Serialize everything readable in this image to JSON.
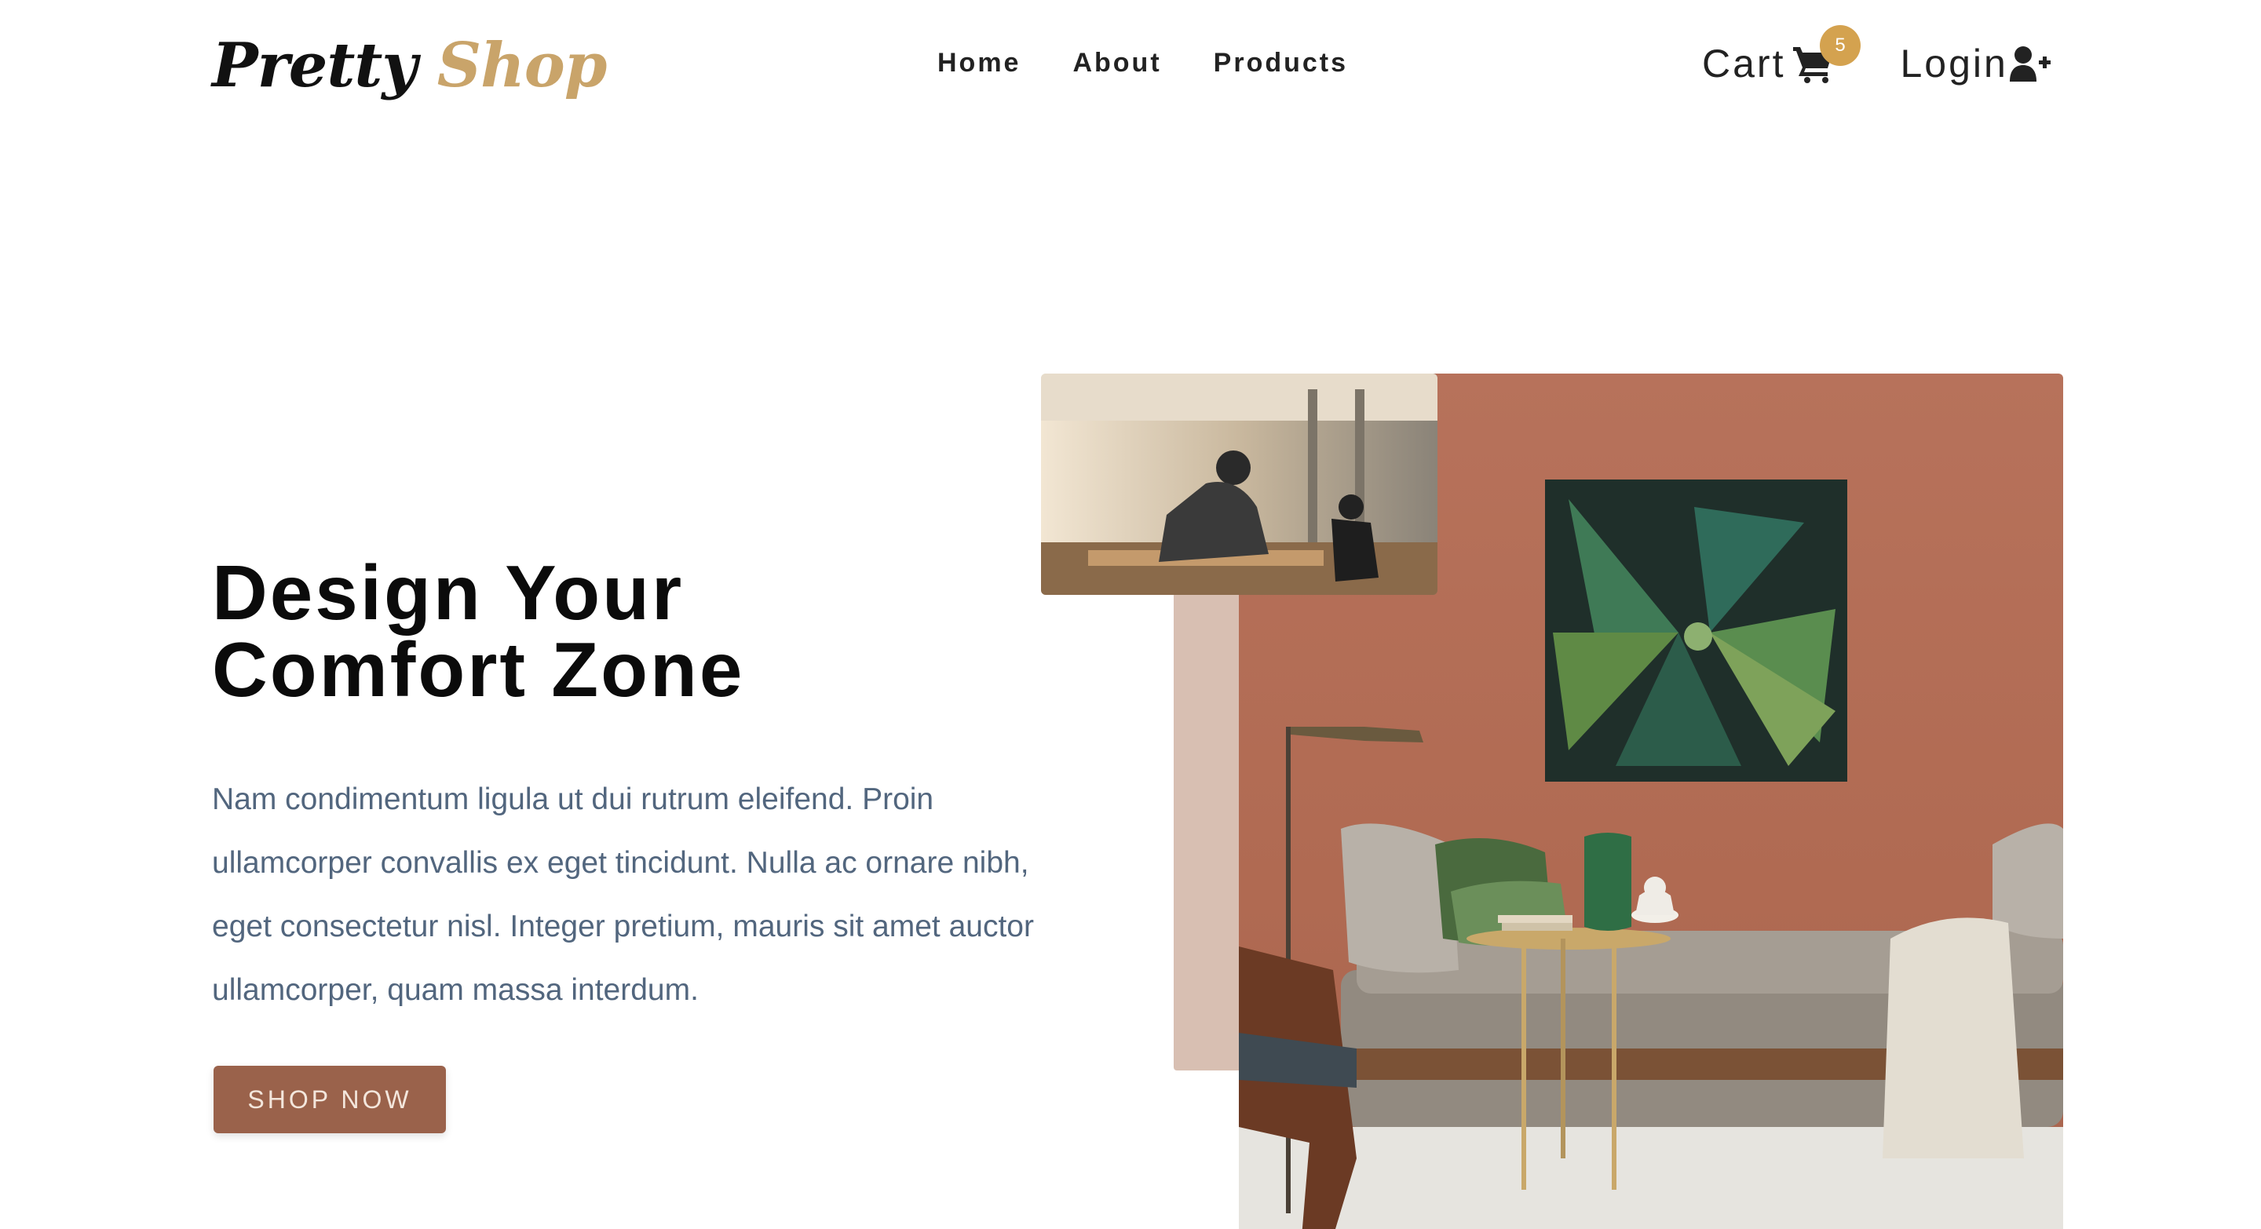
{
  "logo": {
    "part1": "Pretty",
    "part2": "Shop"
  },
  "nav": {
    "links": [
      {
        "label": "Home"
      },
      {
        "label": "About"
      },
      {
        "label": "Products"
      }
    ],
    "cart": {
      "label": "Cart",
      "count": "5",
      "icon": "cart-icon"
    },
    "login": {
      "label": "Login",
      "icon": "user-plus-icon"
    }
  },
  "hero": {
    "title_line1": "Design Your",
    "title_line2": "Comfort Zone",
    "text": "Nam condimentum ligula ut dui rutrum eleifend. Proin ullamcorper convallis ex eget tincidunt. Nulla ac ornare nibh, eget consectetur nisl. Integer pretium, mauris sit amet auctor ullamcorper, quam massa interdum.",
    "cta_label": "SHOP NOW"
  },
  "colors": {
    "brand_gold": "#c9a46a",
    "badge": "#d4a24f",
    "cta": "#9a624b",
    "accent_block": "#d8bfb2",
    "wall": "#b7725b",
    "body_text": "#52667e"
  }
}
